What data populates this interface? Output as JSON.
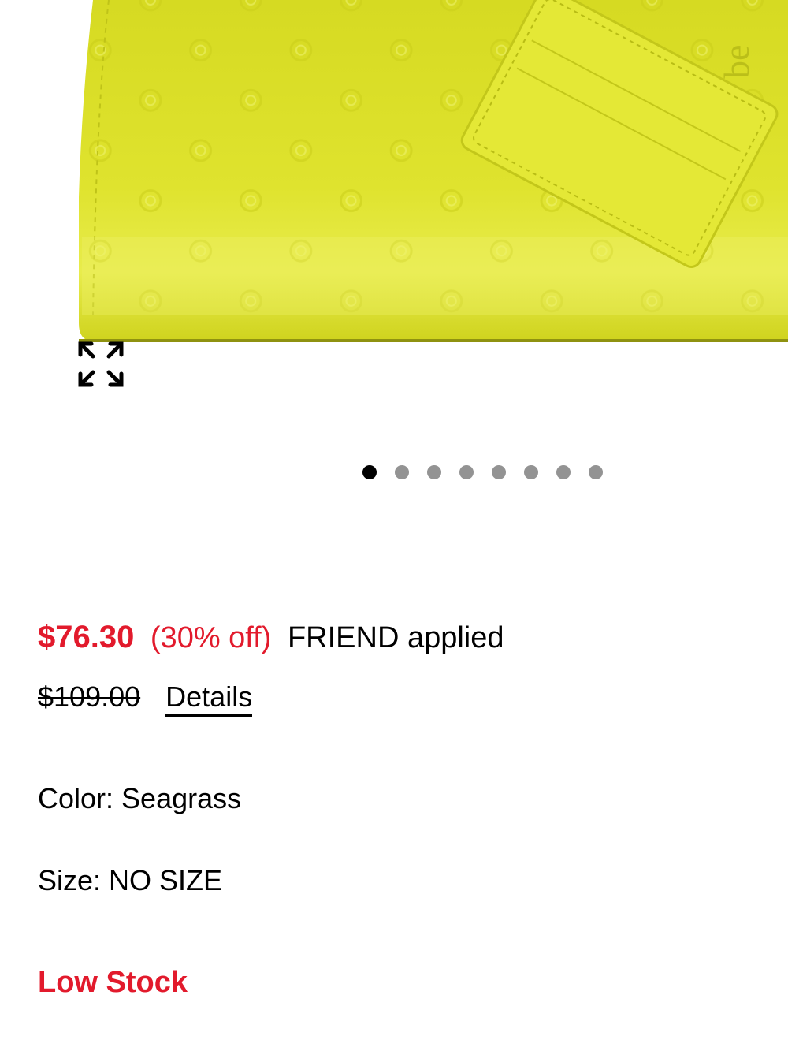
{
  "product_image": {
    "alt_icon": "expand-icon",
    "bag_color": "#dfe32a"
  },
  "carousel": {
    "total": 8,
    "active_index": 0
  },
  "pricing": {
    "sale_price": "$76.30",
    "discount": "(30% off)",
    "promo": "FRIEND applied",
    "original_price": "$109.00",
    "details_label": "Details"
  },
  "attributes": {
    "color": "Color: Seagrass",
    "size": "Size: NO SIZE"
  },
  "stock": {
    "status": "Low Stock"
  },
  "colors": {
    "accent_red": "#e21a2c",
    "dot_inactive": "#939393",
    "dot_active": "#000000"
  }
}
